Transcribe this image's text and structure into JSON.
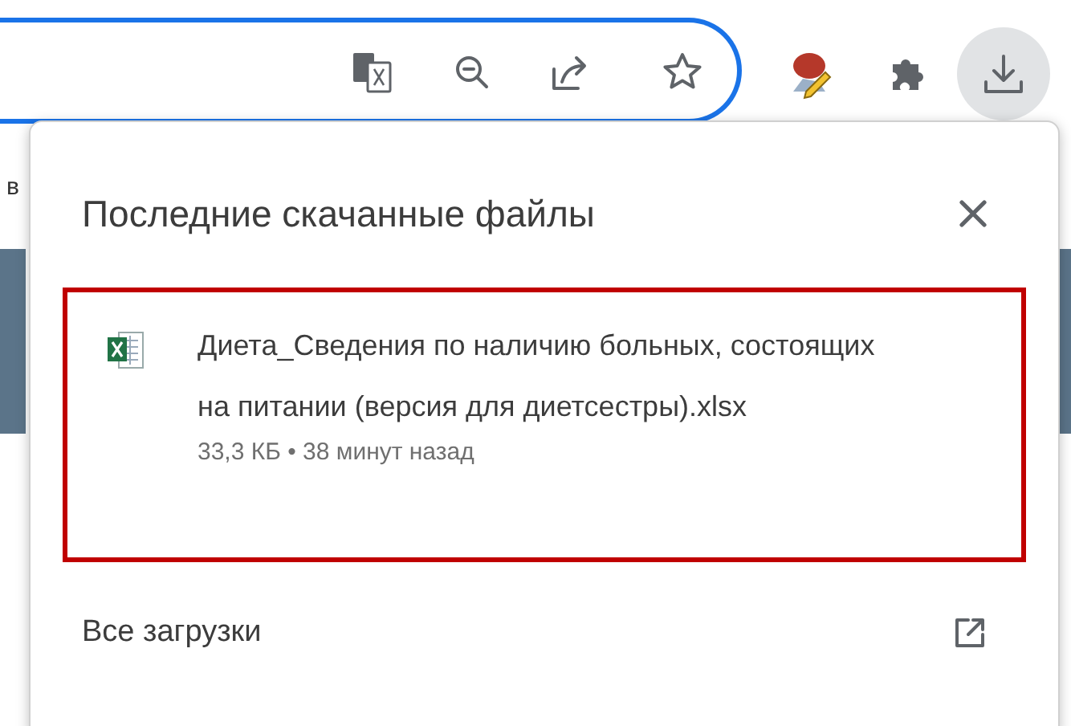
{
  "background_text": "в",
  "downloads_panel": {
    "title": "Последние скачанные файлы",
    "items": [
      {
        "file_name": "Диета_Сведения по наличию больных, состоящих на питании (версия для диетсестры).xlsx",
        "details": "33,3 КБ • 38 минут назад",
        "highlighted": true
      }
    ],
    "footer_link": "Все загрузки"
  }
}
